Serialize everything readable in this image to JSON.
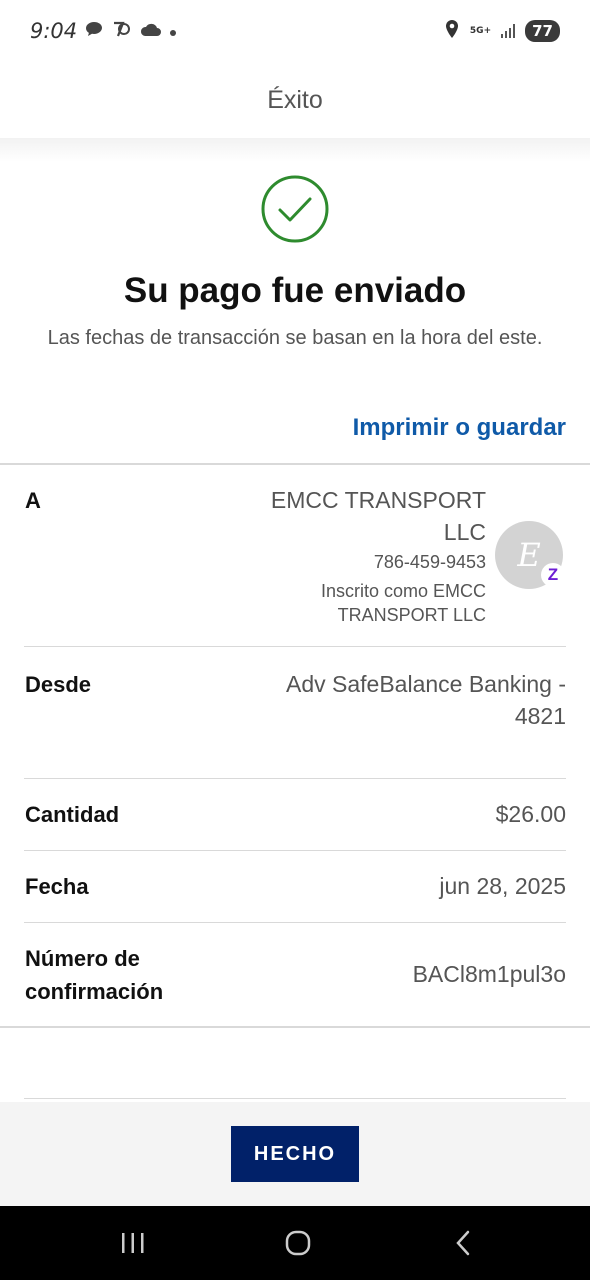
{
  "status_bar": {
    "time": "9:04",
    "network": "5G+",
    "battery": "77",
    "icons": [
      "chat-icon",
      "app-icon",
      "cloud-icon",
      "dot-icon",
      "location-icon",
      "signal-icon",
      "battery-icon"
    ]
  },
  "header": {
    "title": "Éxito"
  },
  "confirmation": {
    "icon": "check-circle-icon",
    "headline": "Su pago fue enviado",
    "subtext": "Las fechas de transacción se basan en la hora del este.",
    "print_link": "Imprimir o guardar"
  },
  "details": {
    "to": {
      "label": "A",
      "name": "EMCC TRANSPORT LLC",
      "phone": "786-459-9453",
      "enrolled": "Inscrito como EMCC TRANSPORT LLC",
      "avatar_letter": "E",
      "badge": "Z"
    },
    "from": {
      "label": "Desde",
      "value": "Adv SafeBalance Banking - 4821"
    },
    "amount": {
      "label": "Cantidad",
      "value": "$26.00"
    },
    "date": {
      "label": "Fecha",
      "value": "jun 28, 2025"
    },
    "confirmation_number": {
      "label": "Número de confirmación",
      "value": "BACl8m1pul3o"
    }
  },
  "footer": {
    "done_label": "HECHO"
  },
  "colors": {
    "accent_link": "#0f5aa8",
    "button_bg": "#012169",
    "success_green": "#2e8b2e",
    "zelle_purple": "#6d1ed4"
  }
}
